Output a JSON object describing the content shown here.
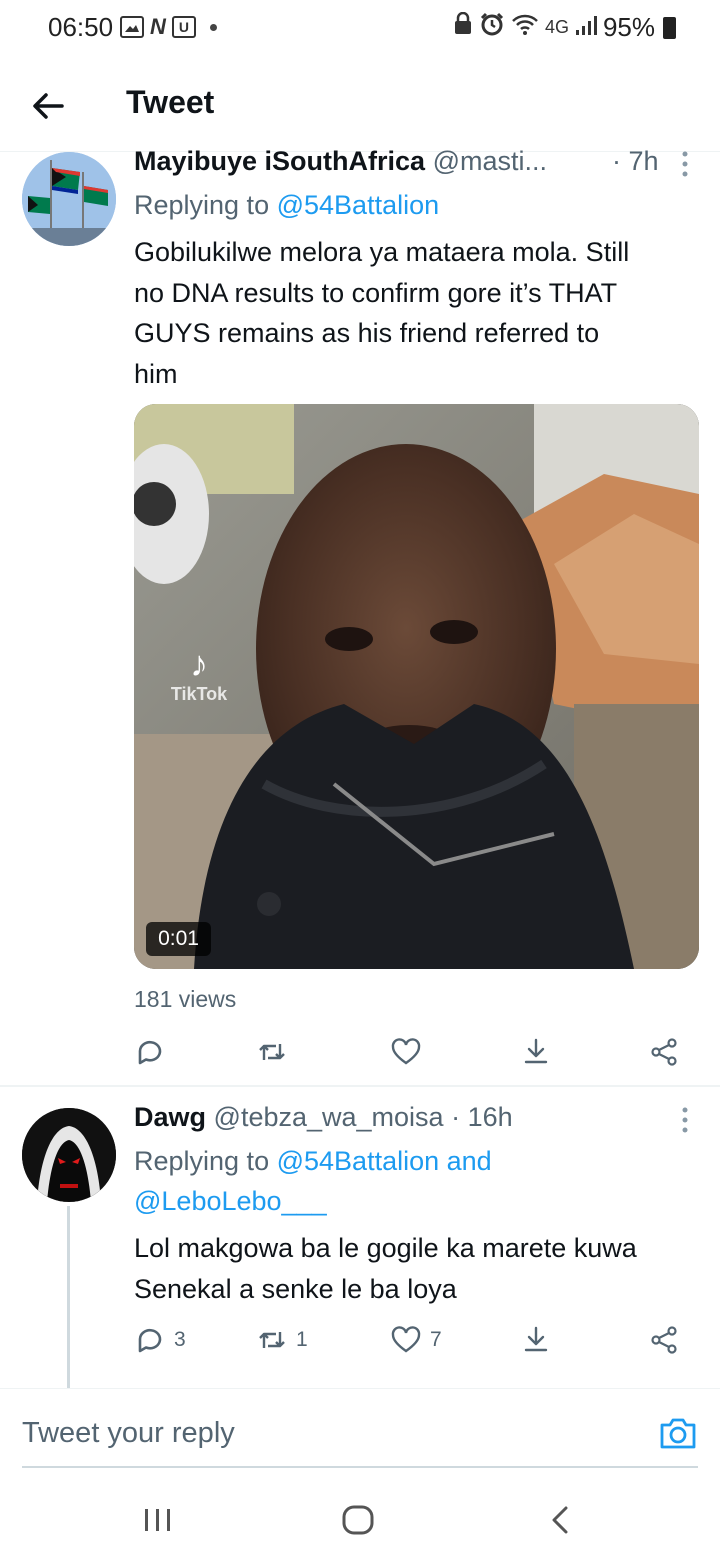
{
  "status_bar": {
    "time": "06:50",
    "network": "4G",
    "battery": "95%"
  },
  "header": {
    "title": "Tweet"
  },
  "tweet1": {
    "display_name": "Mayibuye iSouthAfrica",
    "handle": "@masti...",
    "time": "· 7h",
    "replying_prefix": "Replying to",
    "replying_to": "@54Battalion",
    "text_lines": [
      "Gobilukilwe melora ya mataera mola. Still",
      "no DNA results to confirm gore it’s THAT",
      "GUYS remains as his friend referred to",
      "him"
    ],
    "video_duration": "0:01",
    "watermark": "TikTok",
    "views": "181 views"
  },
  "tweet2": {
    "display_name": "Dawg",
    "handle": "@tebza_wa_moisa",
    "time": "· 16h",
    "replying_prefix": "Replying to",
    "replying_to_1": "@54Battalion",
    "and": "and",
    "replying_to_2": "@LeboLebo___",
    "text_lines": [
      "Lol makgowa ba le gogile ka marete kuwa",
      "Senekal a senke le ba loya"
    ],
    "reply_count": "3",
    "retweet_count": "1",
    "like_count": "7"
  },
  "composer": {
    "placeholder": "Tweet your reply"
  },
  "colors": {
    "link": "#1d9bf0",
    "secondary_text": "#536471",
    "primary_text": "#0f1419"
  }
}
